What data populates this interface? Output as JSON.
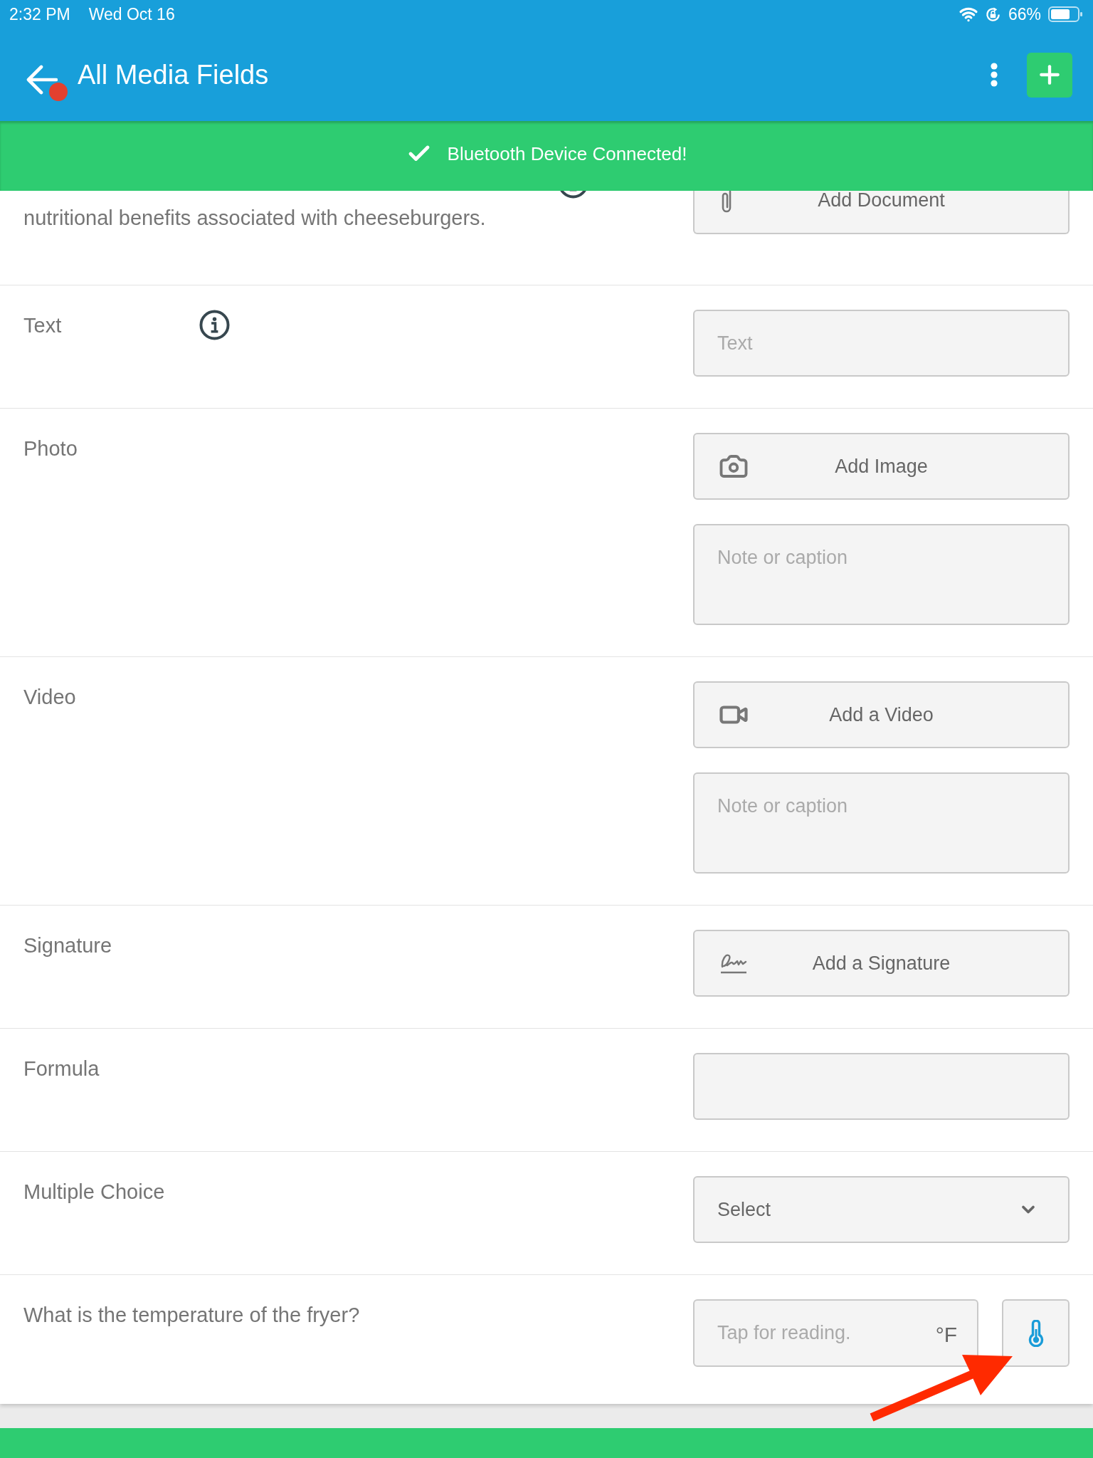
{
  "status_bar": {
    "time": "2:32 PM",
    "date": "Wed Oct 16",
    "battery": "66%"
  },
  "header": {
    "title": "All Media Fields",
    "notification_dot": true
  },
  "banner": {
    "text": "Bluetooth Device Connected!"
  },
  "fields": [
    {
      "kind": "document",
      "clipped": true,
      "info": true,
      "label": "nutritional benefits associated with cheeseburgers.",
      "button": "Add Document"
    },
    {
      "kind": "text",
      "clipped": false,
      "info": true,
      "label": "Text",
      "placeholder": "Text"
    },
    {
      "kind": "photo",
      "clipped": false,
      "info": false,
      "label": "Photo",
      "button": "Add Image",
      "caption_placeholder": "Note or caption"
    },
    {
      "kind": "video",
      "clipped": false,
      "info": false,
      "label": "Video",
      "button": "Add a Video",
      "caption_placeholder": "Note or caption"
    },
    {
      "kind": "signature",
      "clipped": false,
      "info": false,
      "label": "Signature",
      "button": "Add a Signature"
    },
    {
      "kind": "formula",
      "clipped": false,
      "info": false,
      "label": "Formula"
    },
    {
      "kind": "choice",
      "clipped": false,
      "info": false,
      "label": "Multiple Choice",
      "value": "Select"
    },
    {
      "kind": "temperature",
      "clipped": false,
      "info": false,
      "label": "What is the temperature of the fryer?",
      "placeholder": "Tap for reading.",
      "unit": "°F"
    }
  ]
}
